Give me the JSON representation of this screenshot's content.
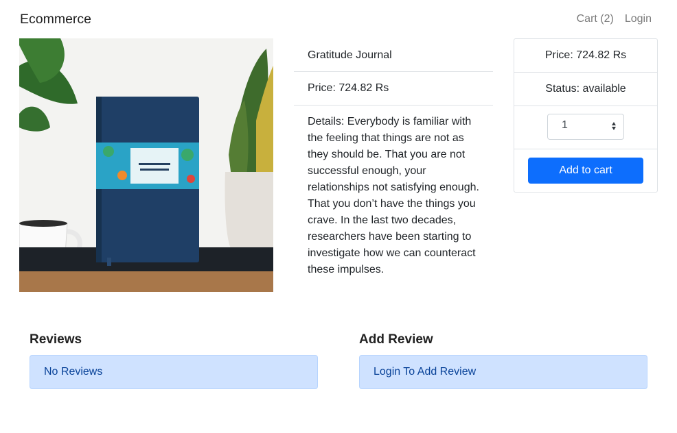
{
  "navbar": {
    "brand": "Ecommerce",
    "cart_label": "Cart (2)",
    "login_label": "Login"
  },
  "product": {
    "image_icon": "journal-product-photo",
    "name": "Gratitude Journal",
    "price_text": "Price: 724.82 Rs",
    "details_text": "Details: Everybody is familiar with the feeling that things are not as they should be. That you are not successful enough, your relationships not satisfying enough. That you don’t have the things you crave. In the last two decades, researchers have been starting to investigate how we can counteract these impulses."
  },
  "purchase_card": {
    "price_text": "Price: 724.82 Rs",
    "status_text": "Status: available",
    "quantity": "1",
    "add_to_cart_label": "Add to cart"
  },
  "reviews": {
    "title": "Reviews",
    "empty_text": "No Reviews"
  },
  "add_review": {
    "title": "Add Review",
    "login_prompt": "Login To Add Review"
  },
  "colors": {
    "primary": "#0d6efd",
    "alert_bg": "#cfe2ff",
    "alert_text": "#084298"
  }
}
